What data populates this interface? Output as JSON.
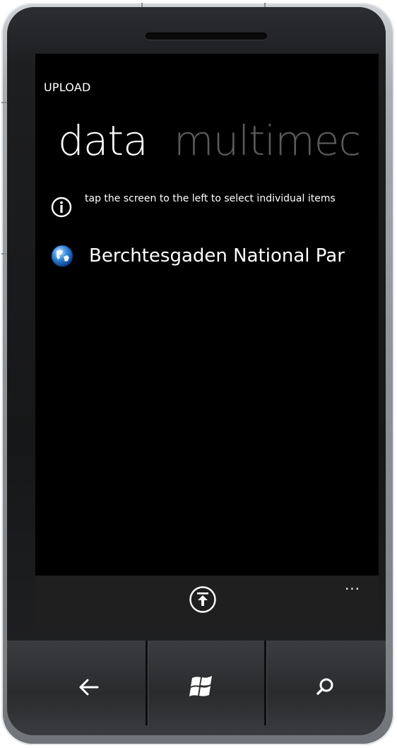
{
  "app": {
    "title": "UPLOAD"
  },
  "pivot": {
    "active_label": "data",
    "inactive_label": "multimec"
  },
  "info": {
    "icon": "info-circle-icon",
    "text": "tap the screen to the left to select individual items"
  },
  "list": {
    "items": [
      {
        "icon": "globe-icon",
        "label": "Berchtesgaden National Par"
      }
    ]
  },
  "appbar": {
    "upload_icon": "upload-icon",
    "more_label": "..."
  },
  "hardware": {
    "back_icon": "back-arrow-icon",
    "start_icon": "windows-logo-icon",
    "search_icon": "search-icon"
  },
  "colors": {
    "accent_text": "#ffffff",
    "inactive_pivot": "#5a5a5a",
    "screen_bg": "#000000",
    "appbar_bg": "#1f1f1f"
  }
}
